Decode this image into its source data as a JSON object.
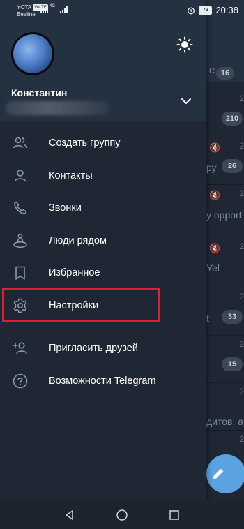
{
  "status_bar": {
    "carrier_1": "YOTA",
    "volte": "VoLTE",
    "network_type": "4G",
    "carrier_2": "Beeline",
    "battery": "72",
    "time": "20:38"
  },
  "drawer": {
    "user_name": "Константин",
    "menu_items": [
      {
        "label": "Создать группу",
        "icon": "group-icon"
      },
      {
        "label": "Контакты",
        "icon": "person-icon"
      },
      {
        "label": "Звонки",
        "icon": "phone-icon"
      },
      {
        "label": "Люди рядом",
        "icon": "people-nearby-icon"
      },
      {
        "label": "Избранное",
        "icon": "bookmark-icon"
      },
      {
        "label": "Настройки",
        "icon": "gear-icon"
      }
    ],
    "secondary_items": [
      {
        "label": "Пригласить друзей",
        "icon": "add-person-icon"
      },
      {
        "label": "Возможности Telegram",
        "icon": "help-icon"
      }
    ],
    "highlight_color": "#e0202d"
  },
  "chat_list_peek": {
    "archive_label": "е",
    "archive_count": "16",
    "rows": [
      {
        "time": "2",
        "snippet": "",
        "count": "210"
      },
      {
        "time": "2",
        "snippet": "ру",
        "count": "26"
      },
      {
        "time": "2",
        "snippet": "y opport",
        "count": ""
      },
      {
        "time": "2",
        "snippet": "Yel",
        "count": ""
      },
      {
        "time": "2",
        "snippet": "t",
        "count": "33"
      },
      {
        "time": "2",
        "snippet": "",
        "count": "15"
      },
      {
        "time": "2",
        "snippet": "",
        "count": ""
      },
      {
        "time": "2",
        "snippet": "дитов, а",
        "count": ""
      }
    ]
  },
  "colors": {
    "drawer_bg": "#1e2733",
    "header_bg": "#243140",
    "fab": "#5aa3e0",
    "accent_highlight": "#e0202d"
  }
}
